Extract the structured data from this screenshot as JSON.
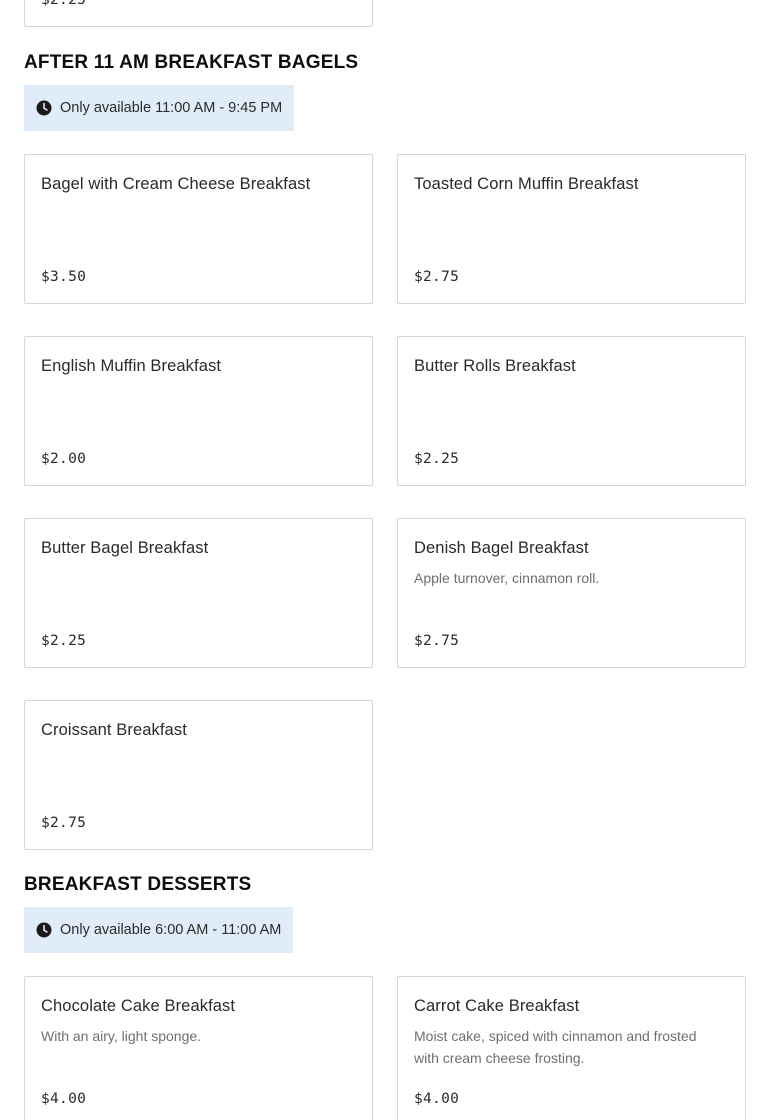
{
  "top_card": {
    "price": "$2.25"
  },
  "sections": [
    {
      "title": "AFTER 11 AM BREAKFAST BAGELS",
      "availability": "Only available 11:00 AM - 9:45 PM",
      "items": [
        {
          "name": "Bagel with Cream Cheese Breakfast",
          "description": "",
          "price": "$3.50"
        },
        {
          "name": "Toasted Corn Muffin Breakfast",
          "description": "",
          "price": "$2.75"
        },
        {
          "name": "English Muffin Breakfast",
          "description": "",
          "price": "$2.00"
        },
        {
          "name": "Butter Rolls Breakfast",
          "description": "",
          "price": "$2.25"
        },
        {
          "name": "Butter Bagel Breakfast",
          "description": "",
          "price": "$2.25"
        },
        {
          "name": "Denish Bagel Breakfast",
          "description": "Apple turnover, cinnamon roll.",
          "price": "$2.75"
        },
        {
          "name": "Croissant Breakfast",
          "description": "",
          "price": "$2.75"
        }
      ]
    },
    {
      "title": "BREAKFAST DESSERTS",
      "availability": "Only available 6:00 AM - 11:00 AM",
      "items": [
        {
          "name": "Chocolate Cake Breakfast",
          "description": "With an airy, light sponge.",
          "price": "$4.00"
        },
        {
          "name": "Carrot Cake Breakfast",
          "description": "Moist cake, spiced with cinnamon and frosted with cream cheese frosting.",
          "price": "$4.00"
        }
      ]
    }
  ],
  "icons": {
    "availability": "clock-icon"
  },
  "colors": {
    "availability_bg": "#e1ecfa",
    "card_border": "#d6d6d6",
    "text": "#191919",
    "muted": "#6f6f6f"
  }
}
